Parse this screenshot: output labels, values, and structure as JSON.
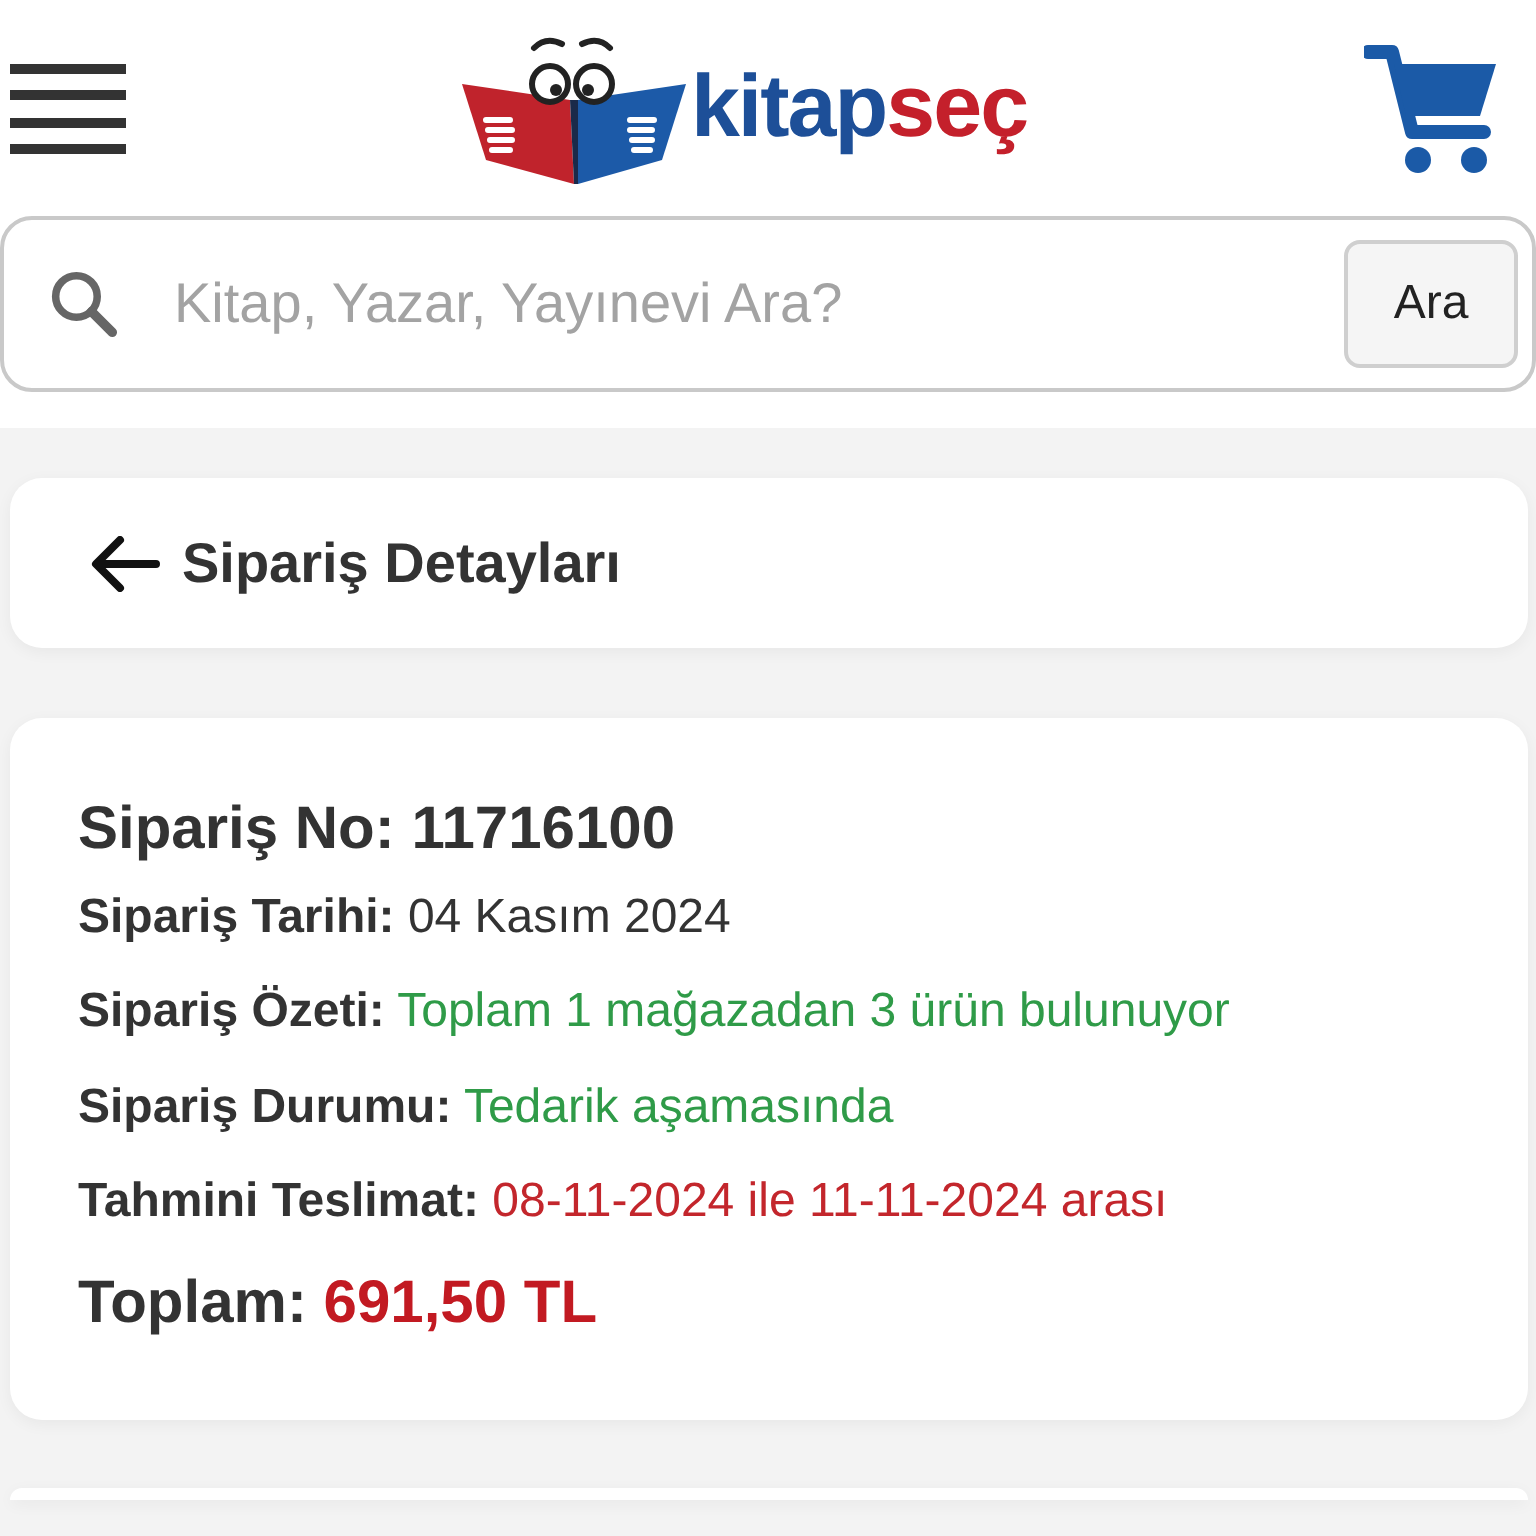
{
  "header": {
    "logo": {
      "parts": [
        {
          "text": "kitap",
          "color": "#1d4f98"
        },
        {
          "text": "seç",
          "color": "#c4202b"
        }
      ]
    }
  },
  "search": {
    "placeholder": "Kitap, Yazar, Yayınevi Ara?",
    "button": "Ara"
  },
  "page_header": {
    "title": "Sipariş Detayları"
  },
  "order": {
    "number_label": "Sipariş No:",
    "number_value": "11716100",
    "fields": [
      {
        "label": "Sipariş Tarihi:",
        "value": "04 Kasım 2024",
        "kind": "plain"
      },
      {
        "label": "Sipariş Özeti:",
        "value": "Toplam 1 mağazadan 3 ürün bulunuyor",
        "kind": "success"
      },
      {
        "label": "Sipariş Durumu:",
        "value": "Tedarik aşamasında",
        "kind": "success"
      },
      {
        "label": "Tahmini Teslimat:",
        "value": "08-11-2024 ile 11-11-2024 arası",
        "kind": "danger"
      }
    ],
    "total_label": "Toplam:",
    "total_value": "691,50 TL"
  }
}
